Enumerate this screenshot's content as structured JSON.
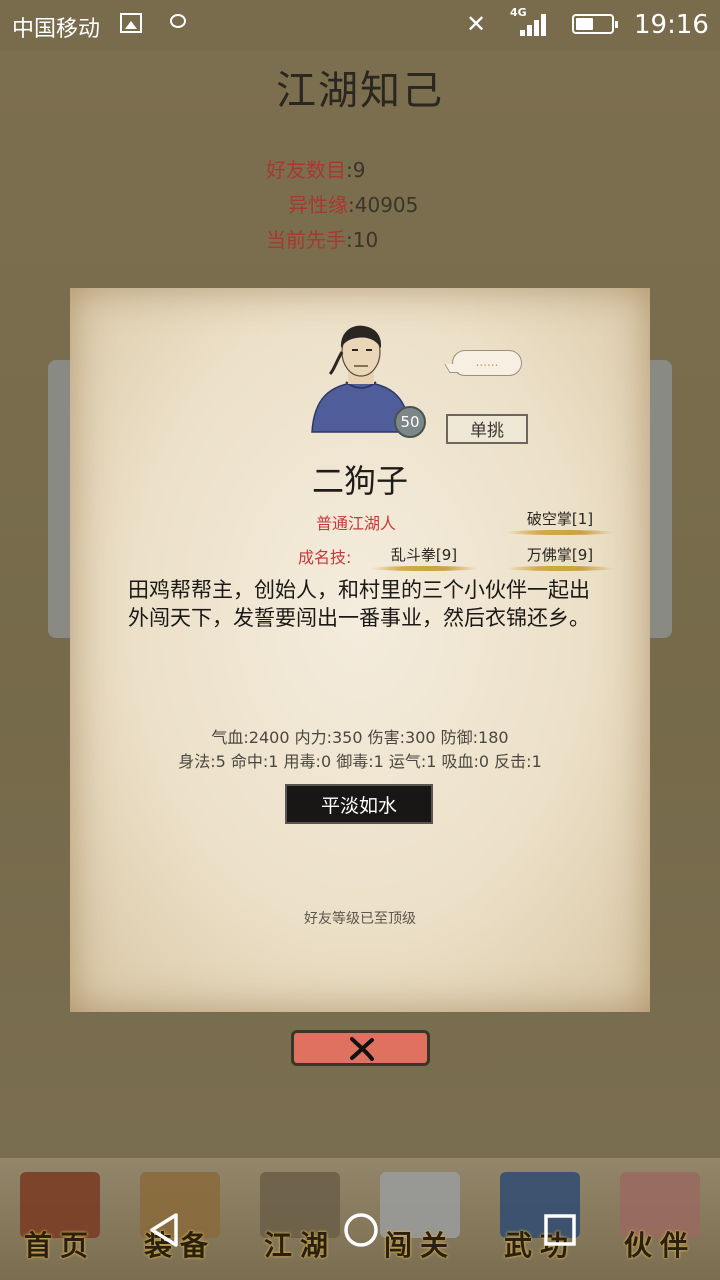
{
  "status_bar": {
    "carrier": "中国移动",
    "network": "4G",
    "time": "19:16"
  },
  "page": {
    "title": "江湖知己"
  },
  "stats": [
    {
      "label": "好友数目",
      "value": "9"
    },
    {
      "label": "异性缘",
      "value": "40905"
    },
    {
      "label": "当前先手",
      "value": "10"
    }
  ],
  "npc": {
    "level": "50",
    "speech": "......",
    "duel_label": "单挑",
    "name": "二狗子",
    "title": "普通江湖人",
    "skills_label": "成名技:",
    "skills": [
      "破空掌[1]",
      "乱斗拳[9]",
      "万佛掌[9]"
    ],
    "description": "田鸡帮帮主，创始人，和村里的三个小伙伴一起出外闯天下，发誓要闯出一番事业，然后衣锦还乡。",
    "attr_line1": "气血:2400  内力:350  伤害:300  防御:180",
    "attr_line2": "身法:5  命中:1  用毒:0  御毒:1  运气:1  吸血:0  反击:1",
    "relation_status": "平淡如水",
    "friend_note": "好友等级已至顶级"
  },
  "bottom_nav": [
    {
      "label": "首页",
      "icon": "house-icon",
      "color": "#7a3a22"
    },
    {
      "label": "装备",
      "icon": "armor-icon",
      "color": "#8a6a3a"
    },
    {
      "label": "江湖",
      "icon": "scroll-map-icon",
      "color": "#6b5e48"
    },
    {
      "label": "闯关",
      "icon": "crossed-swords-icon",
      "color": "#9a9c9e"
    },
    {
      "label": "武功",
      "icon": "book-icon",
      "color": "#2f4b72"
    },
    {
      "label": "伙伴",
      "icon": "partners-icon",
      "color": "#9a6a60"
    }
  ],
  "colors": {
    "accent_red": "#c43b3b",
    "close_button": "#e07060",
    "gold_underline": "#d3a94a"
  }
}
